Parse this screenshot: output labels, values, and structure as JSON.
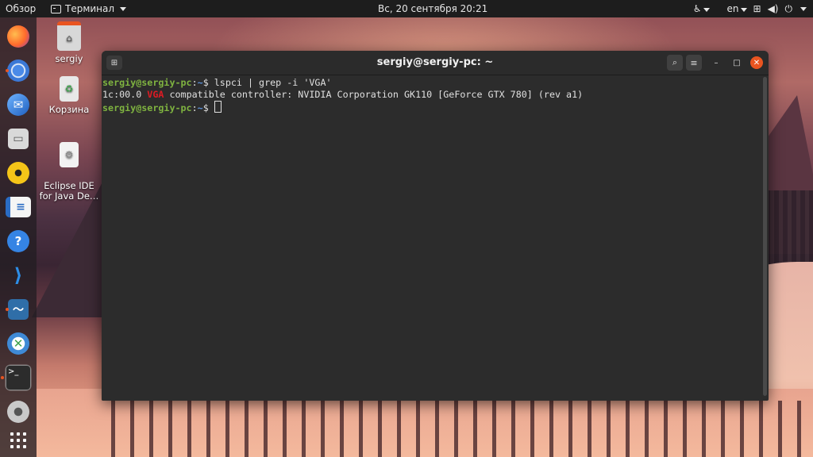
{
  "topbar": {
    "overview": "Обзор",
    "app_name": "Терминал",
    "clock": "Вс, 20 сентября  20:21",
    "language": "en"
  },
  "desktop": {
    "icons": [
      {
        "label": "sergiy",
        "icon": "home-folder-icon"
      },
      {
        "label": "Корзина",
        "icon": "trash-icon"
      },
      {
        "label": "Eclipse IDE\nfor Java De…",
        "icon": "eclipse-launcher-icon"
      }
    ]
  },
  "dock": {
    "apps": [
      "firefox-icon",
      "chromium-icon",
      "thunderbird-icon",
      "files-icon",
      "rhythmbox-icon",
      "writer-icon",
      "help-icon",
      "vscode-icon",
      "system-monitor-icon",
      "app-store-icon",
      "terminal-icon",
      "settings-icon",
      "show-apps-icon"
    ]
  },
  "window": {
    "title": "sergiy@sergiy-pc: ~"
  },
  "terminal": {
    "line1": {
      "user": "sergiy@sergiy-pc",
      "sep": ":",
      "path": "~",
      "prompt": "$ ",
      "cmd": "lspci | grep -i 'VGA'"
    },
    "line2": {
      "pre": "1c:00.0 ",
      "match": "VGA",
      "post": " compatible controller: NVIDIA Corporation GK110 [GeForce GTX 780] (rev a1)"
    },
    "line3": {
      "user": "sergiy@sergiy-pc",
      "sep": ":",
      "path": "~",
      "prompt": "$ "
    }
  },
  "colors": {
    "accent": "#e95420",
    "prompt_user": "#7fb340",
    "prompt_path": "#5a8fd8",
    "grep_match": "#e01b24"
  }
}
